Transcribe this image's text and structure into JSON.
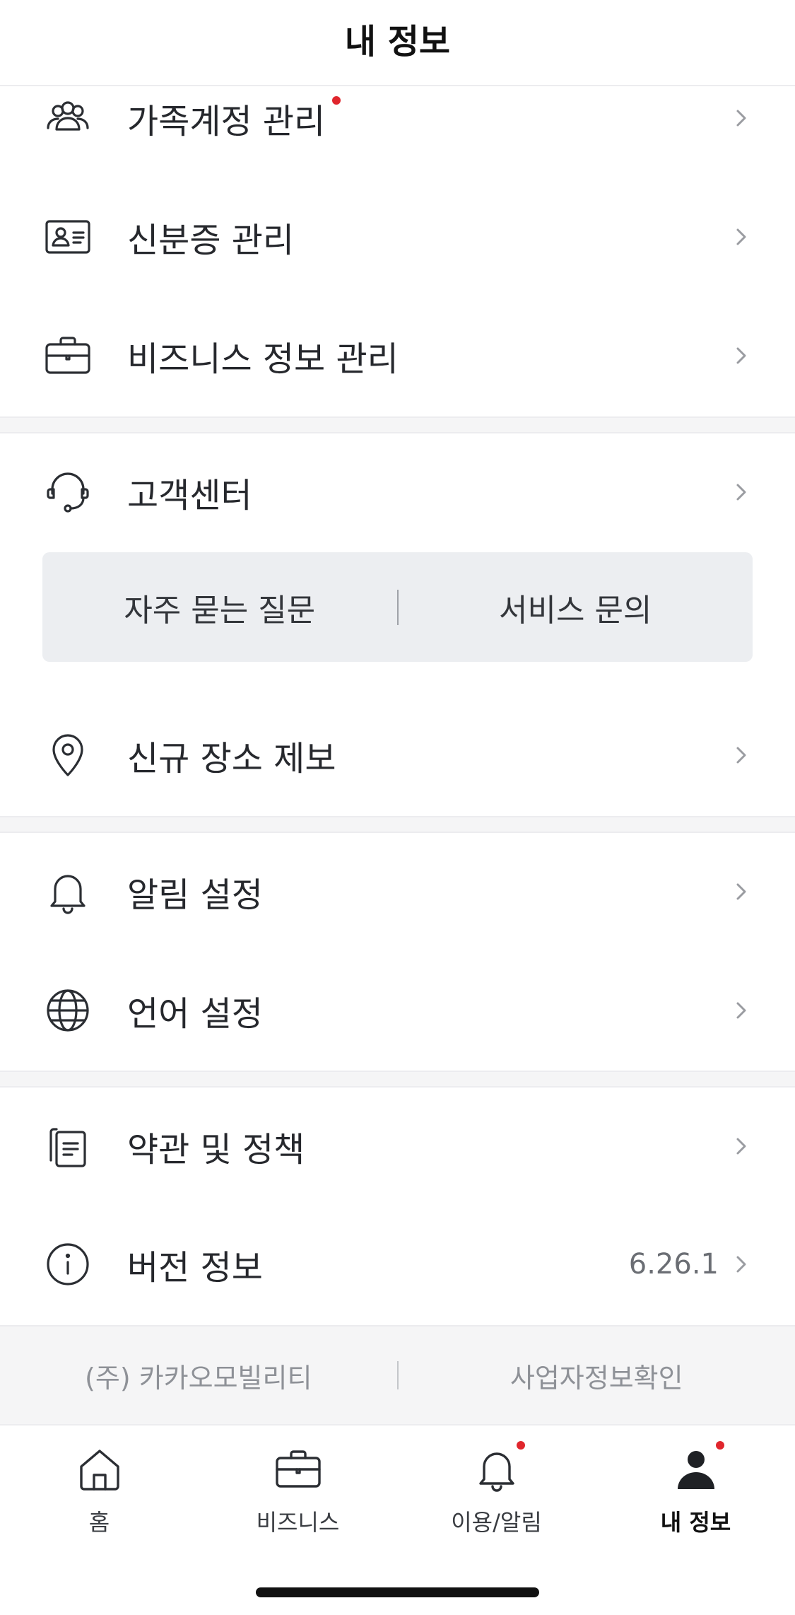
{
  "header": {
    "title": "내 정보"
  },
  "menu_group_1": [
    {
      "label": "가족계정 관리",
      "icon": "family-icon",
      "has_dot": true
    },
    {
      "label": "신분증 관리",
      "icon": "id-card-icon"
    },
    {
      "label": "비즈니스 정보 관리",
      "icon": "briefcase-icon"
    }
  ],
  "support": {
    "label": "고객센터",
    "icon": "headset-icon",
    "faq_label": "자주 묻는 질문",
    "inquiry_label": "서비스 문의"
  },
  "place_report": {
    "label": "신규 장소 제보",
    "icon": "location-pin-icon"
  },
  "settings": [
    {
      "label": "알림 설정",
      "icon": "bell-icon"
    },
    {
      "label": "언어 설정",
      "icon": "globe-icon"
    }
  ],
  "info": [
    {
      "label": "약관 및 정책",
      "icon": "document-icon"
    },
    {
      "label": "버전 정보",
      "icon": "info-icon",
      "value": "6.26.1"
    }
  ],
  "footer": {
    "company": "(주) 카카오모빌리티",
    "business_info": "사업자정보확인"
  },
  "tabbar": [
    {
      "label": "홈",
      "icon": "home-icon"
    },
    {
      "label": "비즈니스",
      "icon": "briefcase-icon"
    },
    {
      "label": "이용/알림",
      "icon": "bell-icon",
      "has_dot": true
    },
    {
      "label": "내 정보",
      "icon": "person-icon",
      "has_dot": true,
      "active": true
    }
  ],
  "colors": {
    "accent_dot": "#e0262d",
    "text_primary": "#26282d",
    "chevron": "#9a9ca1",
    "section_bg": "#f5f5f6",
    "faq_bg": "#eceef1"
  }
}
